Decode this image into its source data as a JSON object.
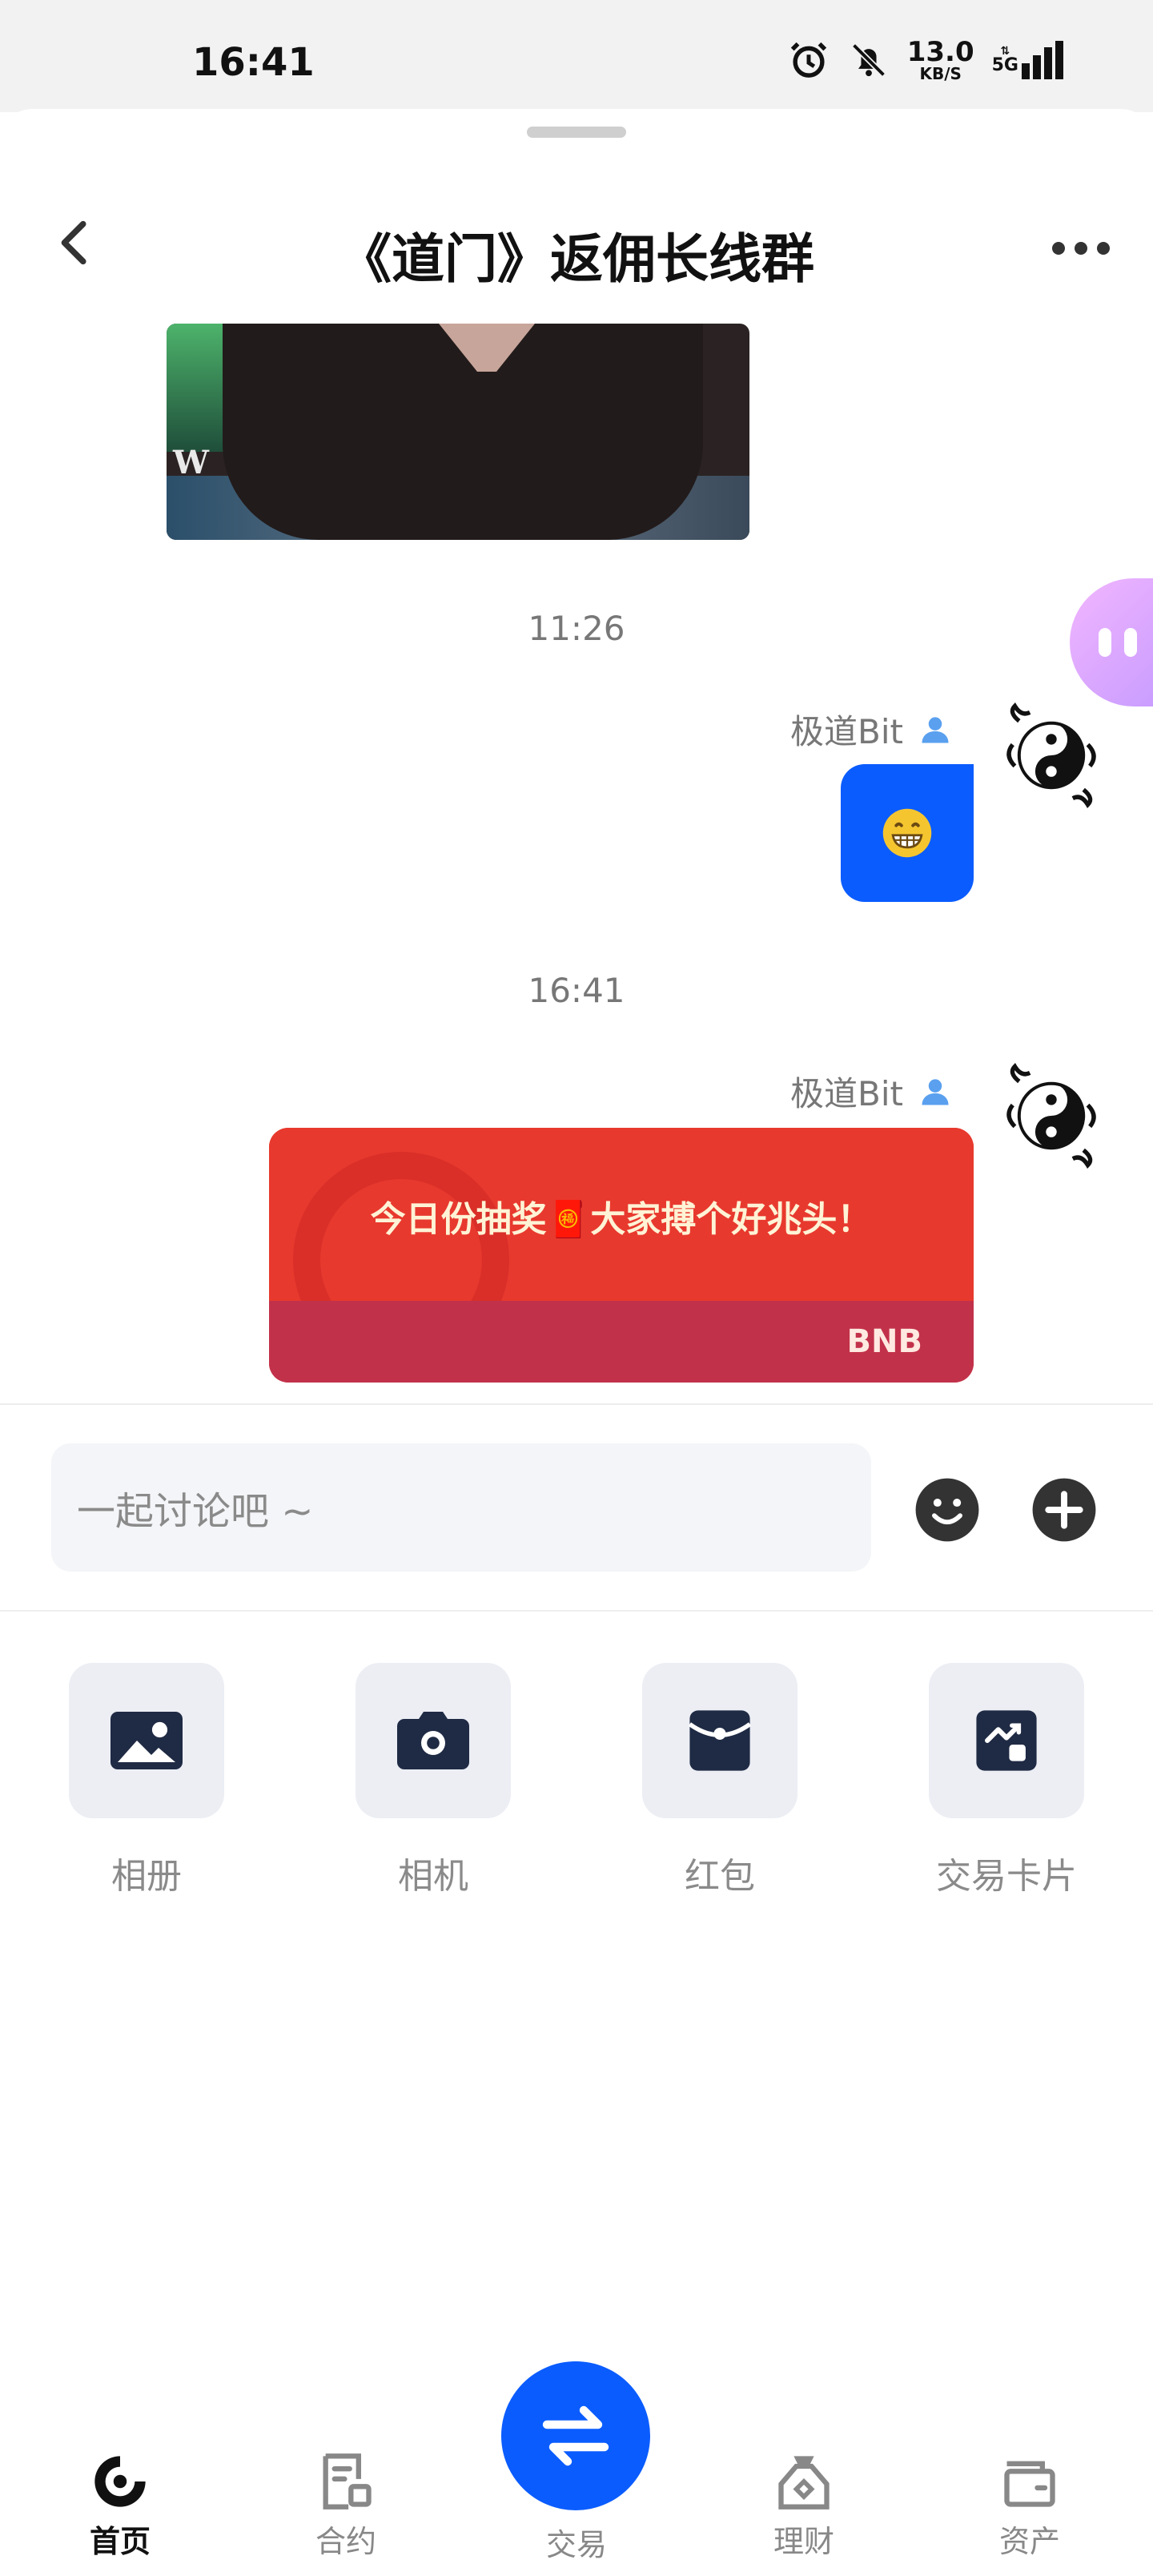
{
  "status_bar": {
    "time": "16:41",
    "net_speed_value": "13.0",
    "net_speed_unit": "KB/S",
    "network": "5G"
  },
  "header": {
    "title": "《道门》返佣长线群"
  },
  "chat": {
    "messages": [
      {
        "timestamp": "11:26",
        "sender": "极道Bit",
        "content_type": "emoji",
        "content": "😁"
      },
      {
        "timestamp": "16:41",
        "sender": "极道Bit",
        "content_type": "red_packet",
        "content": "今日份抽奖🧧大家搏个好兆头！",
        "coin": "BNB"
      }
    ]
  },
  "input": {
    "placeholder": "一起讨论吧 ~"
  },
  "attach_panel": {
    "items": [
      {
        "label": "相册",
        "icon": "photo-album-icon"
      },
      {
        "label": "相机",
        "icon": "camera-icon"
      },
      {
        "label": "红包",
        "icon": "red-packet-icon"
      },
      {
        "label": "交易卡片",
        "icon": "trade-card-icon"
      }
    ]
  },
  "bottom_nav": {
    "items": [
      {
        "label": "首页",
        "icon": "home-icon",
        "active": true
      },
      {
        "label": "合约",
        "icon": "contract-icon",
        "active": false
      },
      {
        "label": "交易",
        "icon": "trade-icon",
        "active": false
      },
      {
        "label": "理财",
        "icon": "finance-icon",
        "active": false
      },
      {
        "label": "资产",
        "icon": "assets-icon",
        "active": false
      }
    ]
  },
  "colors": {
    "accent": "#0a5cff",
    "red_packet": "#e8392e",
    "red_packet_footer": "#c2314a"
  }
}
